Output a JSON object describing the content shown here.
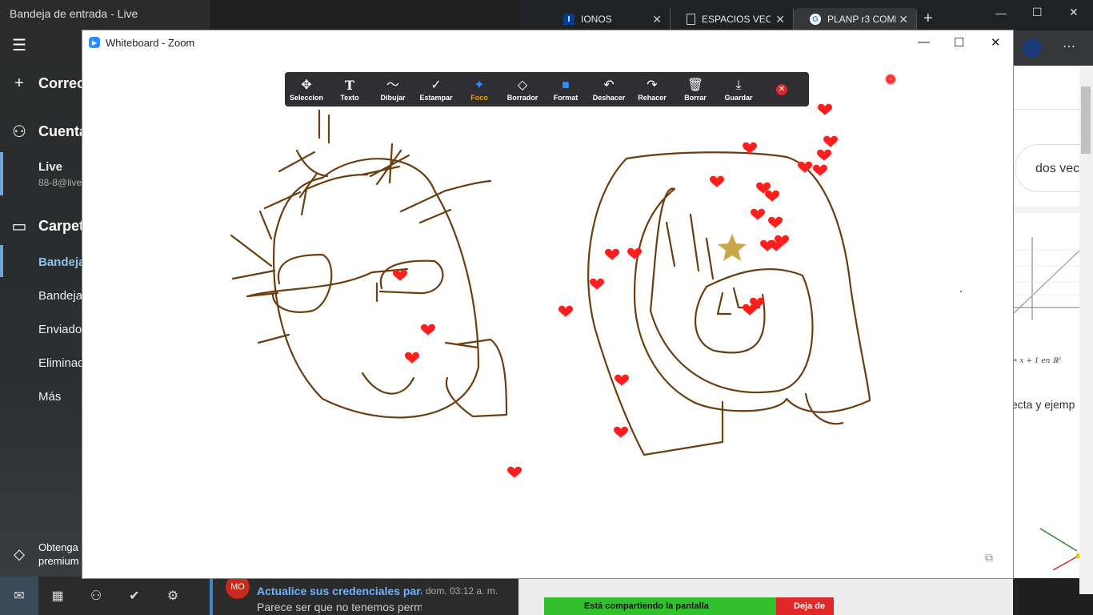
{
  "mail": {
    "window_title": "Bandeja de entrada - Live",
    "nav": [
      {
        "icon": "hamburger-icon",
        "label": ""
      },
      {
        "icon": "plus-icon",
        "label": "Correo"
      },
      {
        "icon": "person-icon",
        "label": "Cuenta"
      }
    ],
    "account": {
      "name": "Live",
      "email": "88-8@live"
    },
    "folders_header": "Carpet",
    "folders": [
      "Bandeja",
      "Bandeja",
      "Enviados",
      "Eliminad",
      "Más"
    ],
    "premium": {
      "line1": "Obtenga",
      "line2": "premium"
    },
    "message": {
      "avatar": "MO",
      "subject": "Actualice sus credenciales para",
      "date": "dom. 03:12 a. m.",
      "preview": "Parece ser que no tenemos perm"
    }
  },
  "browser": {
    "tabs": [
      {
        "icon": "I",
        "label": "IONOS"
      },
      {
        "icon": "doc-icon",
        "label": "ESPACIOS VECTO"
      },
      {
        "icon": "google-icon",
        "label": "PLANP r3 COMPL"
      }
    ],
    "new_tab": "+",
    "search_chip": "dos vec",
    "graph_equation": "= x + 1 en ℝ²",
    "result_text": "ecta y ejemp",
    "share_status": "Está compartiendo la pantalla",
    "stop_share": "Deja de"
  },
  "zoom": {
    "title": "Whiteboard - Zoom",
    "tools": [
      {
        "name": "tool-seleccion",
        "icon": "✥",
        "label": "Seleccion"
      },
      {
        "name": "tool-texto",
        "icon": "T",
        "label": "Texto"
      },
      {
        "name": "tool-dibujar",
        "icon": "〜",
        "label": "Dibujar"
      },
      {
        "name": "tool-estampar",
        "icon": "✓",
        "label": "Estampar"
      },
      {
        "name": "tool-foco",
        "icon": "✦",
        "label": "Foco"
      },
      {
        "name": "tool-borrador",
        "icon": "◇",
        "label": "Borrador"
      },
      {
        "name": "tool-format",
        "icon": "■",
        "label": "Format"
      },
      {
        "name": "tool-deshacer",
        "icon": "↶",
        "label": "Deshacer"
      },
      {
        "name": "tool-rehacer",
        "icon": "↷",
        "label": "Rehacer"
      },
      {
        "name": "tool-borrar",
        "icon": "🗑",
        "label": "Borrar"
      },
      {
        "name": "tool-guardar",
        "icon": "⤓",
        "label": "Guardar"
      }
    ],
    "colors": {
      "ink": "#6b3e10",
      "heart": "#ff1e1e",
      "star": "#c9a84c",
      "focus": "#f0a300"
    }
  }
}
